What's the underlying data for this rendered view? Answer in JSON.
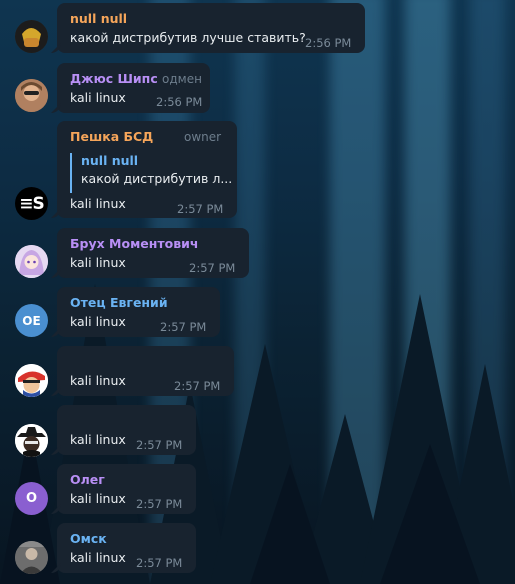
{
  "messages": [
    {
      "id": "m1",
      "sender": "null null",
      "role": "",
      "text": "какой дистрибутив лучше ставить?",
      "time": "2:56 PM",
      "name_color": "#f5a55a",
      "avatar": "anime-character-avatar"
    },
    {
      "id": "m2",
      "sender": "Джюс Шипс",
      "role": "одмен",
      "text": "kali linux",
      "time": "2:56 PM",
      "name_color": "#b88ff5",
      "avatar": "photo-avatar"
    },
    {
      "id": "m3",
      "sender": "Пешка БСД",
      "role": "owner",
      "text": "kali linux",
      "time": "2:57 PM",
      "name_color": "#f5a55a",
      "avatar": "es-logo-avatar",
      "reply": {
        "sender": "null null",
        "text": "какой дистрибутив л..."
      }
    },
    {
      "id": "m4",
      "sender": "Брух Моментович",
      "role": "",
      "text": "kali linux",
      "time": "2:57 PM",
      "name_color": "#b88ff5",
      "avatar": "anime-girl-avatar"
    },
    {
      "id": "m5",
      "sender": "Отец Евгений",
      "role": "",
      "text": "kali linux",
      "time": "2:57 PM",
      "name_color": "#6ab3f3",
      "avatar": "initials-avatar",
      "initials": "ОЕ"
    },
    {
      "id": "m6",
      "sender": "",
      "role": "",
      "text": "kali linux",
      "time": "2:57 PM",
      "name_color": "",
      "avatar": "cartoon-avatar"
    },
    {
      "id": "m7",
      "sender": "",
      "role": "",
      "text": "kali linux",
      "time": "2:57 PM",
      "name_color": "",
      "avatar": "cowboy-avatar"
    },
    {
      "id": "m8",
      "sender": "Олег",
      "role": "",
      "text": "kali linux",
      "time": "2:57 PM",
      "name_color": "#b88ff5",
      "avatar": "initials-avatar",
      "initials": "О"
    },
    {
      "id": "m9",
      "sender": "Омск",
      "role": "",
      "text": "kali linux",
      "time": "2:57 PM",
      "name_color": "#6ab3f3",
      "avatar": "photo-avatar"
    }
  ],
  "colors": {
    "bubble": "#18232f",
    "accent": "#6ab3f3",
    "time": "#7a8a98"
  }
}
